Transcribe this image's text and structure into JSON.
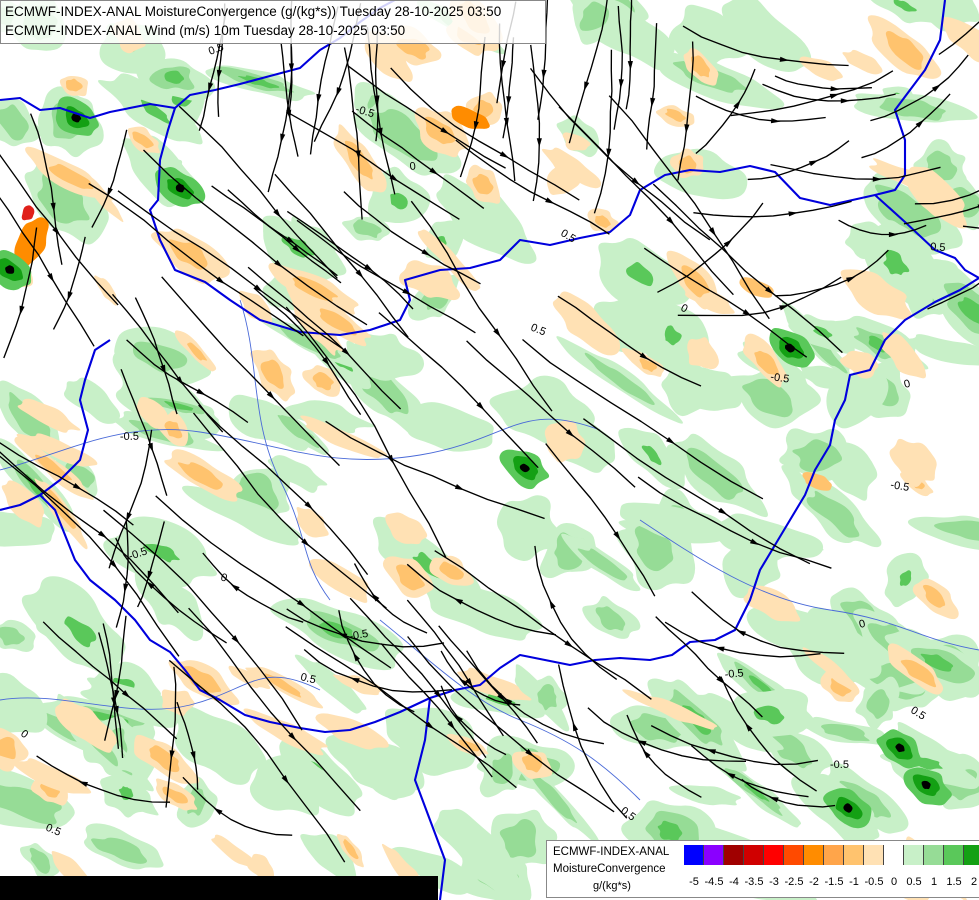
{
  "title": {
    "line1": "ECMWF-INDEX-ANAL MoistureConvergence (g/(kg*s)) Tuesday 28-10-2025 03:50",
    "line2": "ECMWF-INDEX-ANAL Wind (m/s) 10m Tuesday 28-10-2025 03:50"
  },
  "legend": {
    "model": "ECMWF-INDEX-ANAL",
    "parameter": "MoistureConvergence",
    "units": "g/(kg*s)",
    "tick_labels": [
      "-5",
      "-4.5",
      "-4",
      "-3.5",
      "-3",
      "-2.5",
      "-2",
      "-1.5",
      "-1",
      "-0.5",
      "0",
      "0.5",
      "1",
      "1.5",
      "2"
    ],
    "colors": [
      "#0000ff",
      "#8a00ff",
      "#a00000",
      "#d00000",
      "#ff0000",
      "#ff4a00",
      "#ff8c00",
      "#ffa54a",
      "#ffc36e",
      "#ffe1b4",
      "#ffffff",
      "#c8f0c8",
      "#96dc96",
      "#5ac85a",
      "#14a014"
    ]
  },
  "contour_labels": [
    "0.5",
    "-0.5",
    "0",
    "0.5",
    "-0.5",
    "0",
    "0.5",
    "-0.5",
    "0",
    "0.5",
    "-0.5",
    "0",
    "0.5",
    "-0.5",
    "0",
    "-0.5",
    "0.5",
    "-0.5",
    "0",
    "0.5",
    "-0.5",
    "0.5"
  ],
  "map": {
    "fill_colors": {
      "background": "#ffffff",
      "green_light": "#c8f0c8",
      "green_mid": "#96dc96",
      "green_dark": "#5ac85a",
      "green_deep": "#14a014",
      "orange_light": "#ffe1b4",
      "orange_mid": "#ffc36e",
      "orange_strong": "#ff8c00",
      "red": "#e0201a"
    },
    "border_color": "#0000dd",
    "river_color": "#4a6ad8",
    "streamline_color": "#000000"
  }
}
